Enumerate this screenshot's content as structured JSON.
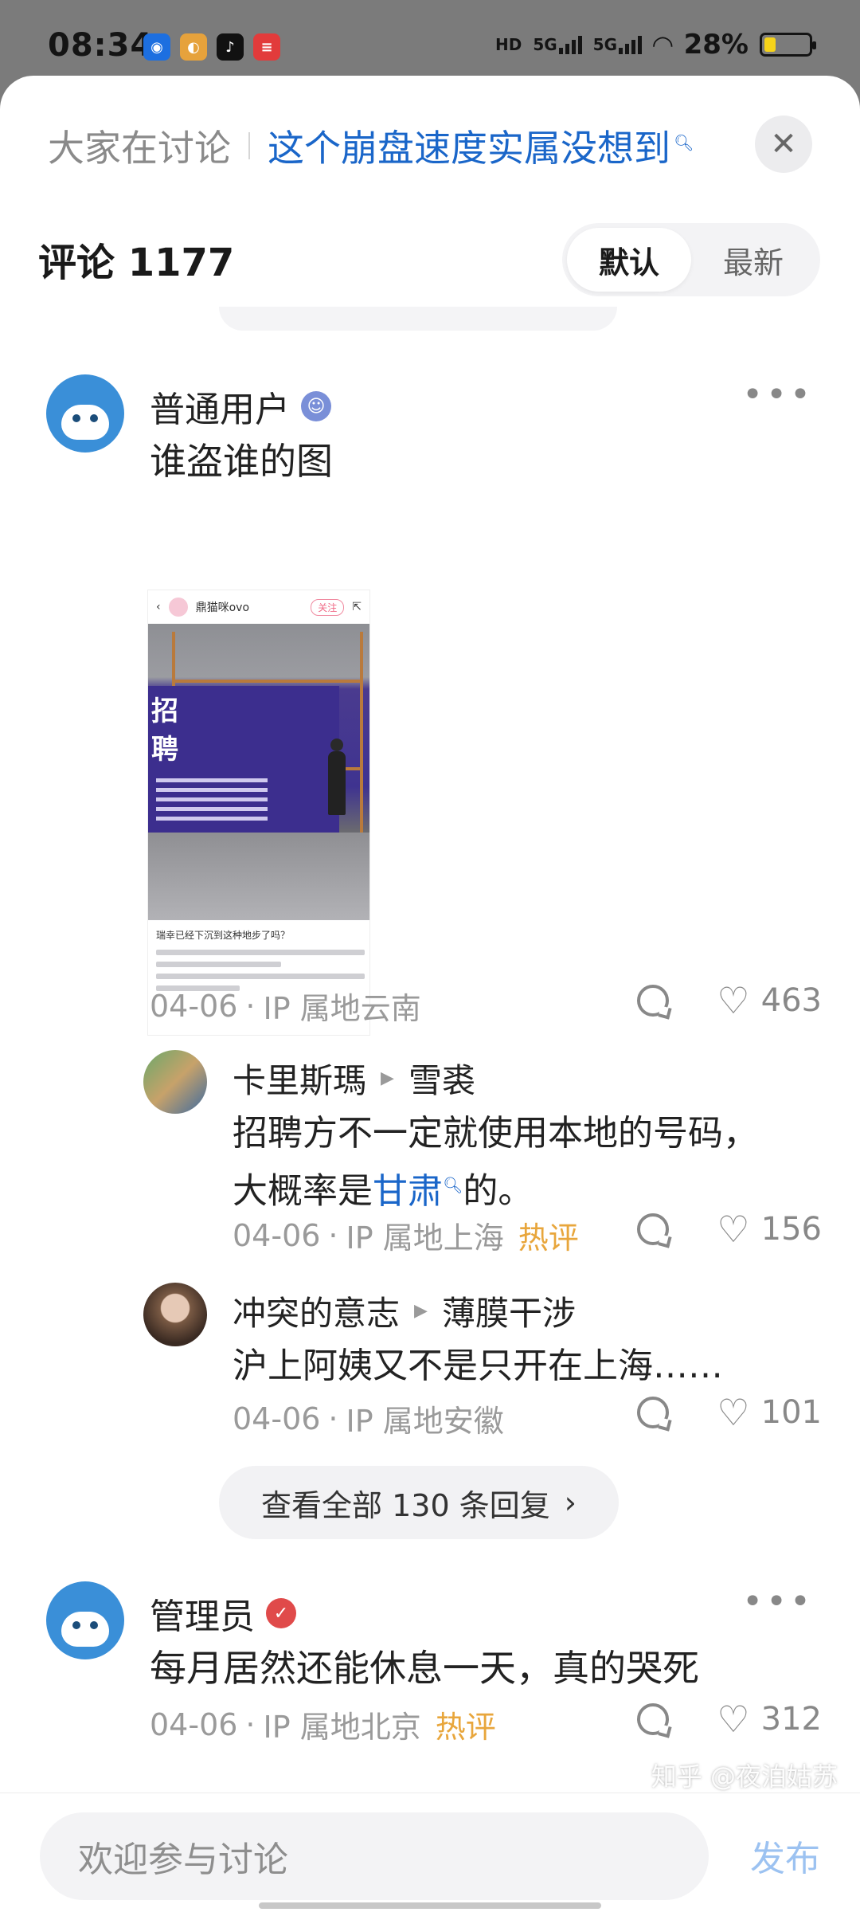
{
  "status_bar": {
    "time": "08:34",
    "hd_label": "HD",
    "net1": "5G",
    "net2": "5G",
    "battery_text": "28%",
    "battery_level": 0.28,
    "app_icons": [
      "browser-icon",
      "weibo-icon",
      "tiktok-icon",
      "news-icon"
    ]
  },
  "topic": {
    "label": "大家在讨论",
    "link": "这个崩盘速度实属没想到"
  },
  "comments_header": {
    "title": "评论 1177",
    "sort_default": "默认",
    "sort_latest": "最新"
  },
  "comments": [
    {
      "username": "普通用户",
      "text": "谁盗谁的图",
      "date": "04-06",
      "ip": "IP 属地云南",
      "likes": "463",
      "embed": {
        "author": "鼎猫咪ovo",
        "follow": "关注",
        "banner_text": "招\n聘",
        "caption": "瑞幸已经下沉到这种地步了吗？"
      },
      "replies": [
        {
          "username": "卡里斯瑪",
          "reply_to": "雪裘",
          "text_line1": "招聘方不一定就使用本地的号码，",
          "text_prefix": "大概率是",
          "text_link": "甘肃",
          "text_suffix": "的。",
          "date": "04-06",
          "ip": "IP 属地上海",
          "hot": "热评",
          "likes": "156"
        },
        {
          "username": "冲突的意志",
          "reply_to": "薄膜干涉",
          "text": "沪上阿姨又不是只开在上海……",
          "date": "04-06",
          "ip": "IP 属地安徽",
          "likes": "101"
        }
      ],
      "view_all": "查看全部 130 条回复"
    },
    {
      "username": "管理员",
      "text": "每月居然还能休息一天，真的哭死",
      "date": "04-06",
      "ip": "IP 属地北京",
      "hot": "热评",
      "likes": "312"
    }
  ],
  "bottom": {
    "placeholder": "欢迎参与讨论",
    "publish": "发布",
    "watermark": "知乎 @夜泊姑苏"
  }
}
